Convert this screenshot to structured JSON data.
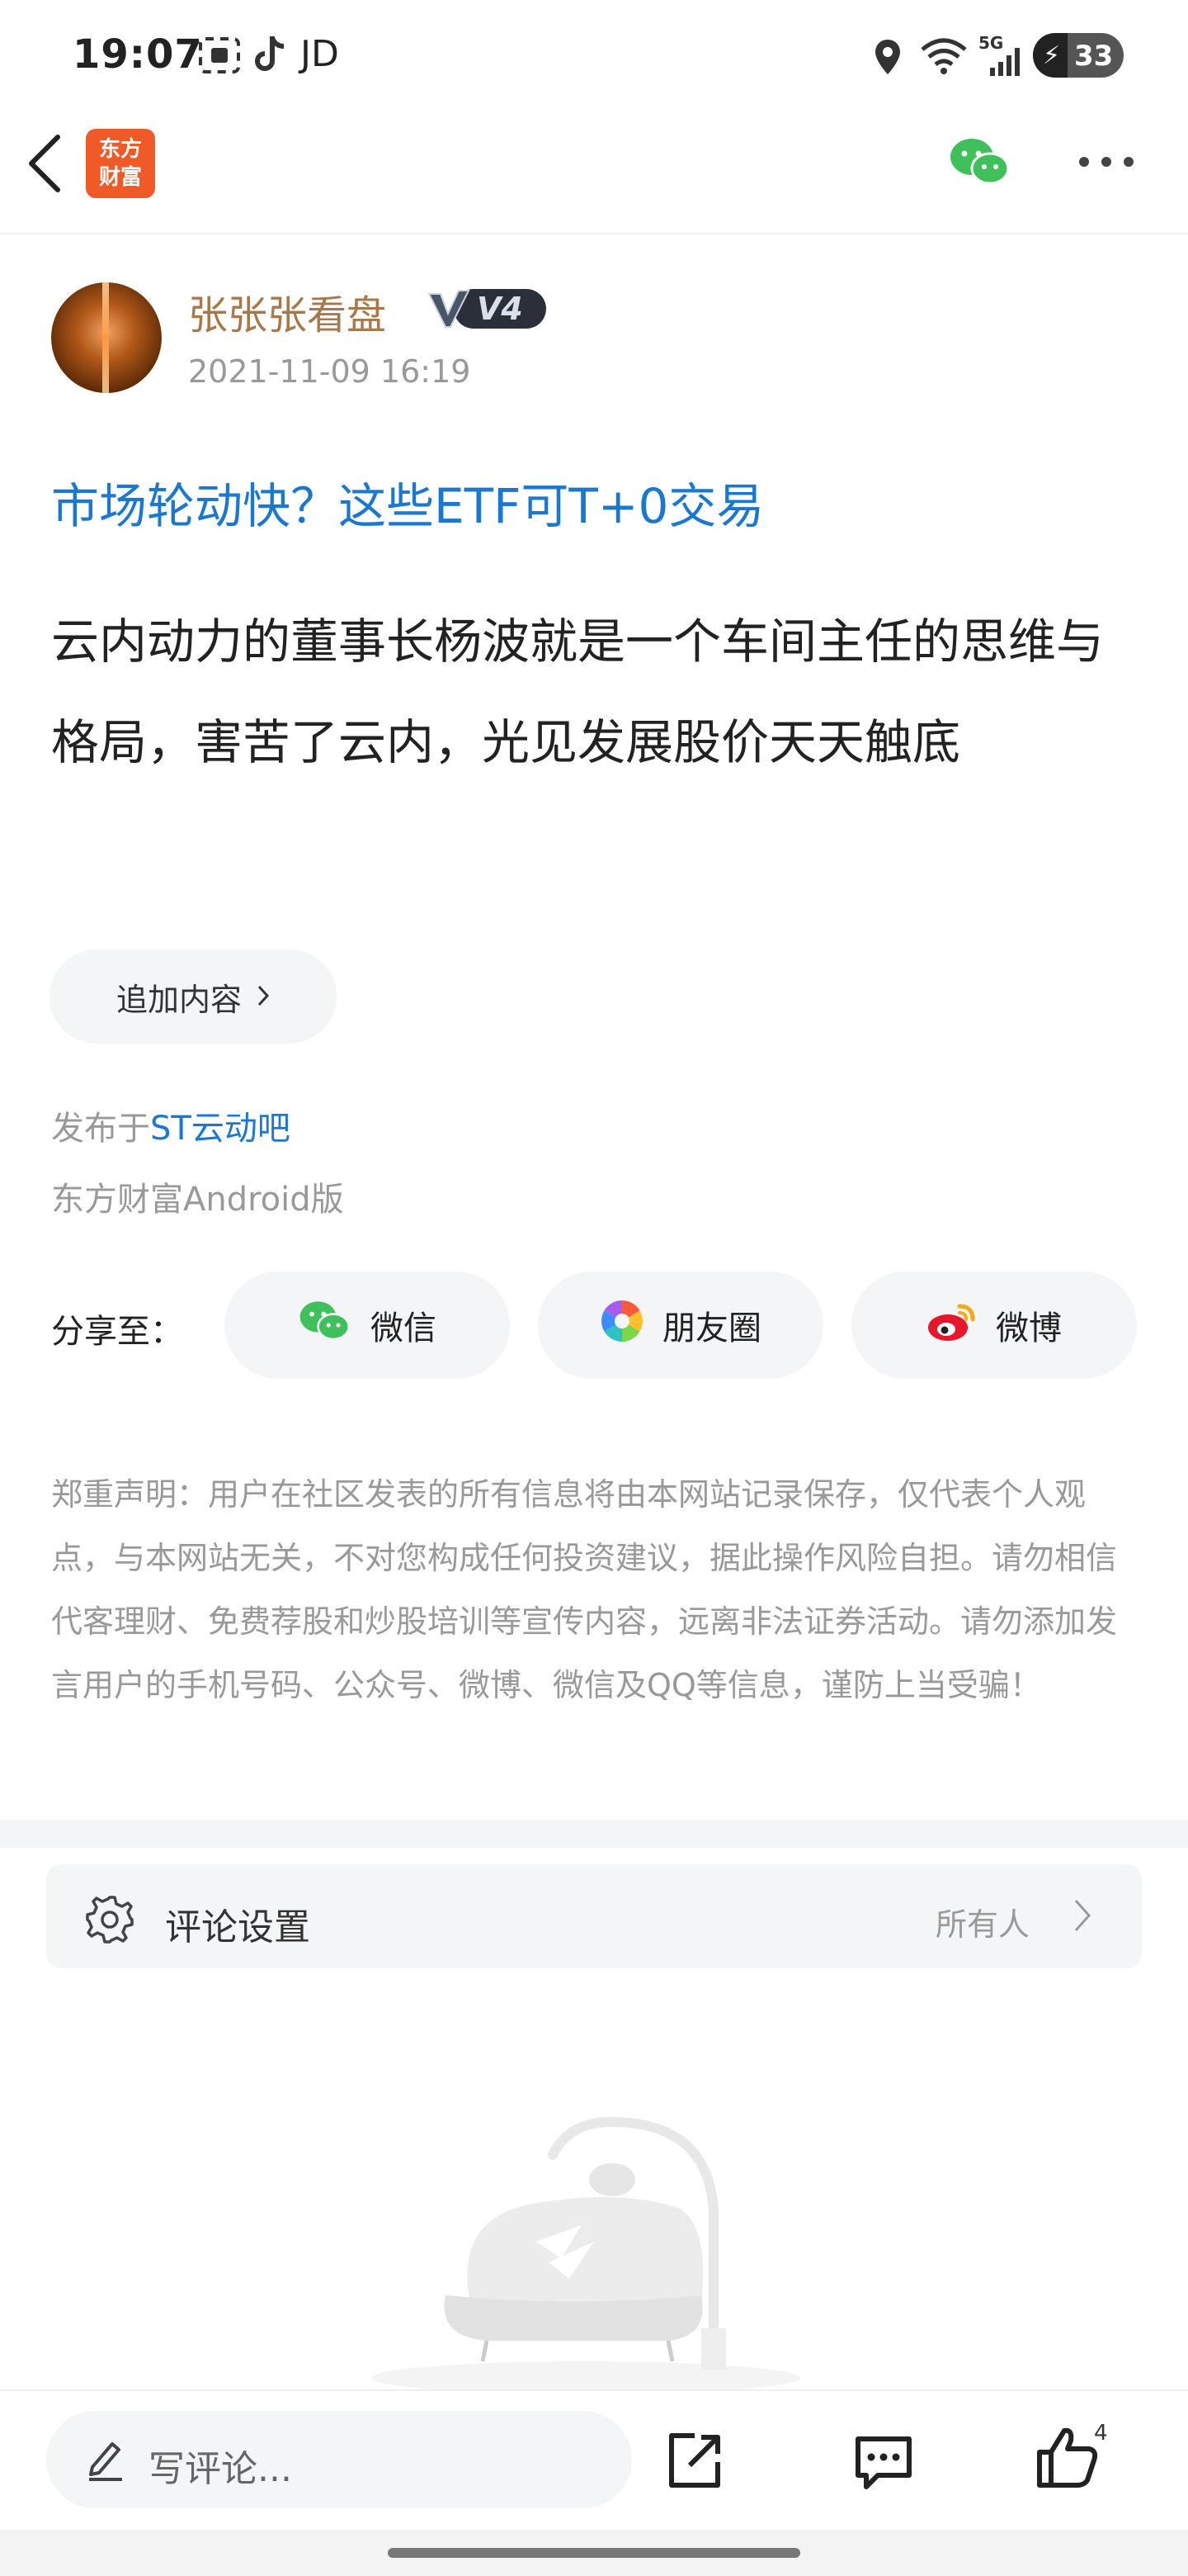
{
  "status_bar": {
    "time": "19:07",
    "app_label": "JD",
    "battery": "33",
    "network": "5G"
  },
  "header": {
    "logo_text": [
      "东方",
      "财富"
    ]
  },
  "post": {
    "author": "张张张看盘",
    "level": "V4",
    "time": "2021-11-09 16:19",
    "title": "市场轮动快？这些ETF可T+0交易",
    "body": "云内动力的董事长杨波就是一个车间主任的思维与格局，害苦了云内，光见发展股价天天触底",
    "append_label": "追加内容",
    "published_prefix": "发布于",
    "forum": "ST云动吧",
    "client": "东方财富Android版"
  },
  "share": {
    "label": "分享至：",
    "targets": [
      "微信",
      "朋友圈",
      "微博"
    ]
  },
  "disclaimer": "郑重声明：用户在社区发表的所有信息将由本网站记录保存，仅代表个人观点，与本网站无关，不对您构成任何投资建议，据此操作风险自担。请勿相信代客理财、免费荐股和炒股培训等宣传内容，远离非法证券活动。请勿添加发言用户的手机号码、公众号、微博、微信及QQ等信息，谨防上当受骗！",
  "comment_settings": {
    "label": "评论设置",
    "value": "所有人"
  },
  "bottom_bar": {
    "comment_placeholder": "写评论...",
    "like_count": "4"
  },
  "colors": {
    "brand_orange": "#ef5a26",
    "link_blue": "#1b78d0",
    "author_gold": "#a9784a",
    "wechat_green": "#3fc05a",
    "weibo_red": "#e6162d"
  }
}
